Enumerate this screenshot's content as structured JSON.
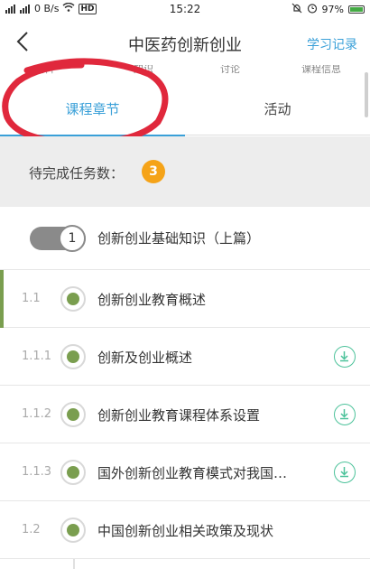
{
  "status_bar": {
    "signal_left": "il",
    "network_speed": "0 B/s",
    "time": "15:22",
    "battery": "97%"
  },
  "header": {
    "title": "中医药创新创业",
    "record_link": "学习记录"
  },
  "top_tabs_truncated": [
    "资料",
    "知识",
    "讨论",
    "课程信息"
  ],
  "tabs": [
    {
      "label": "课程章节",
      "active": true
    },
    {
      "label": "活动",
      "active": false
    }
  ],
  "tasks": {
    "label": "待完成任务数：",
    "count": "3"
  },
  "chapter": {
    "number": "1",
    "title": "创新创业基础知识（上篇）"
  },
  "lessons": [
    {
      "number": "1.1",
      "title": "创新创业教育概述",
      "downloadable": false
    },
    {
      "number": "1.1.1",
      "title": "创新及创业概述",
      "downloadable": true
    },
    {
      "number": "1.1.2",
      "title": "创新创业教育课程体系设置",
      "downloadable": true
    },
    {
      "number": "1.1.3",
      "title": "国外创新创业教育模式对我国…",
      "downloadable": true
    },
    {
      "number": "1.2",
      "title": "中国创新创业相关政策及现状",
      "downloadable": false
    }
  ],
  "colors": {
    "accent": "#3aa0d8",
    "dot_green": "#7a9e4f",
    "badge_orange": "#f5a318",
    "download_green": "#4cc29a",
    "annotation_red": "#e0283c"
  }
}
